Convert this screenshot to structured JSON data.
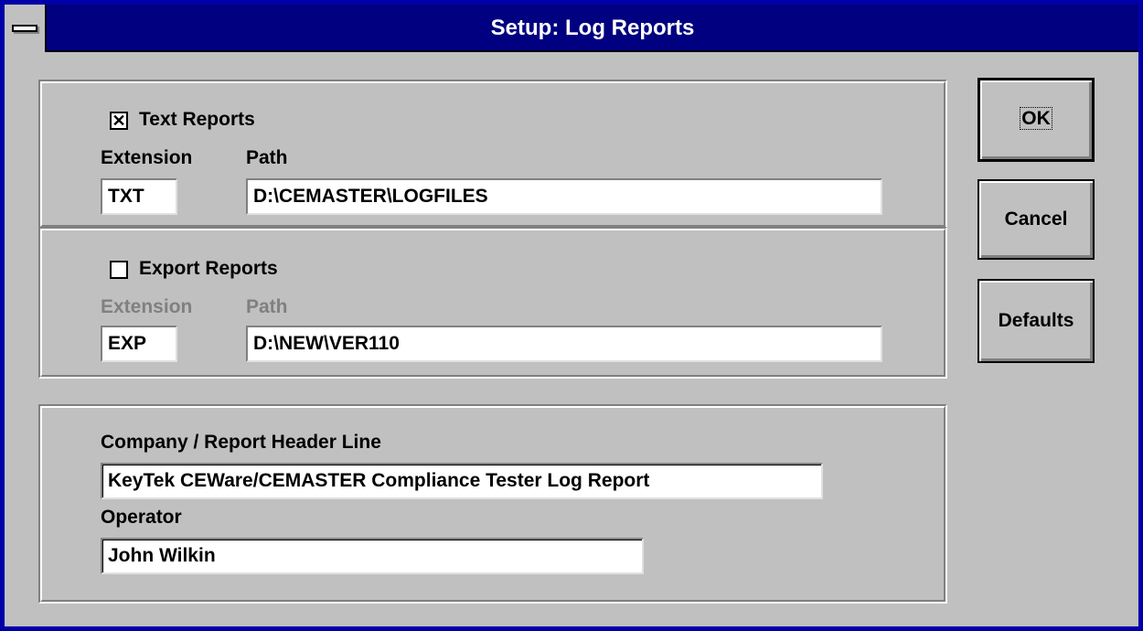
{
  "window": {
    "title": "Setup: Log Reports"
  },
  "text_reports": {
    "checkbox_label": "Text Reports",
    "checked": true,
    "check_mark": "✕",
    "extension_label": "Extension",
    "path_label": "Path",
    "extension_value": "TXT",
    "path_value": "D:\\CEMASTER\\LOGFILES"
  },
  "export_reports": {
    "checkbox_label": "Export Reports",
    "checked": false,
    "extension_label": "Extension",
    "path_label": "Path",
    "extension_value": "EXP",
    "path_value": "D:\\NEW\\VER110"
  },
  "header_section": {
    "company_label": "Company / Report Header Line",
    "company_value": "KeyTek CEWare/CEMASTER Compliance Tester Log Report",
    "operator_label": "Operator",
    "operator_value": "John Wilkin"
  },
  "buttons": {
    "ok": "OK",
    "cancel": "Cancel",
    "defaults": "Defaults"
  },
  "colors": {
    "title_bar": "#000080",
    "face": "#c0c0c0",
    "disabled_text": "#808080"
  }
}
